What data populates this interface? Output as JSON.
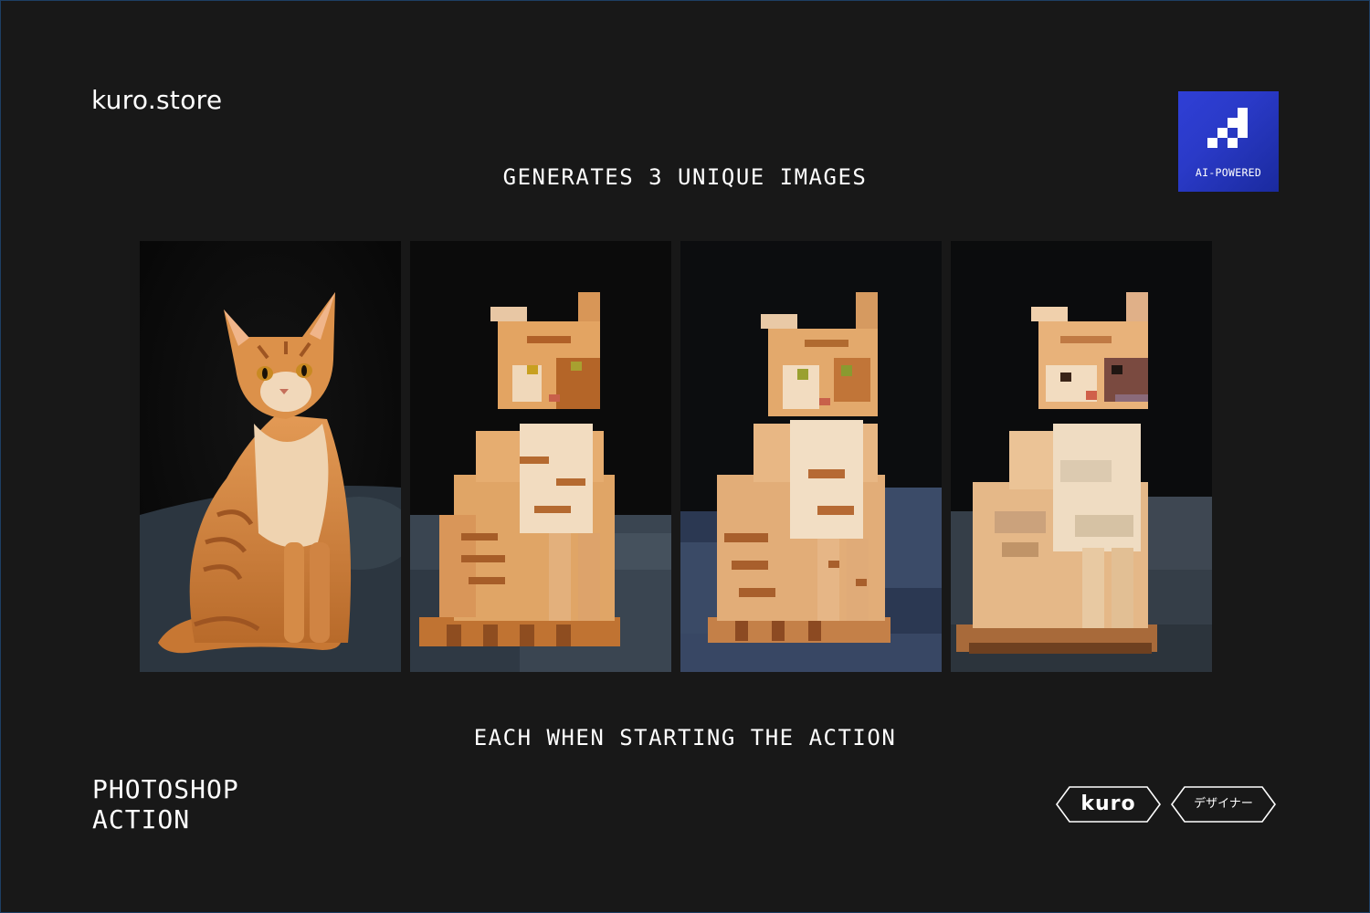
{
  "brand": {
    "name": "kuro.store"
  },
  "headline_top": "GENERATES 3 UNIQUE IMAGES",
  "headline_bottom": "EACH WHEN STARTING THE ACTION",
  "badge": {
    "label": "AI-POWERED",
    "icon": "pixel-staircase-icon",
    "color": "#2a3ac8"
  },
  "gallery": {
    "panels": [
      {
        "kind": "original-photo",
        "subject": "orange tabby cat"
      },
      {
        "kind": "pixel-art-variant-1",
        "subject": "orange tabby cat"
      },
      {
        "kind": "pixel-art-variant-2",
        "subject": "orange tabby cat"
      },
      {
        "kind": "pixel-art-variant-3",
        "subject": "orange tabby cat"
      }
    ]
  },
  "footer": {
    "title_line1": "PHOTOSHOP",
    "title_line2": "ACTION"
  },
  "tags": {
    "kuro": "kuro",
    "designer": "デザイナー"
  },
  "colors": {
    "background": "#181818",
    "cat_orange": "#d9873f",
    "text": "#ffffff"
  }
}
